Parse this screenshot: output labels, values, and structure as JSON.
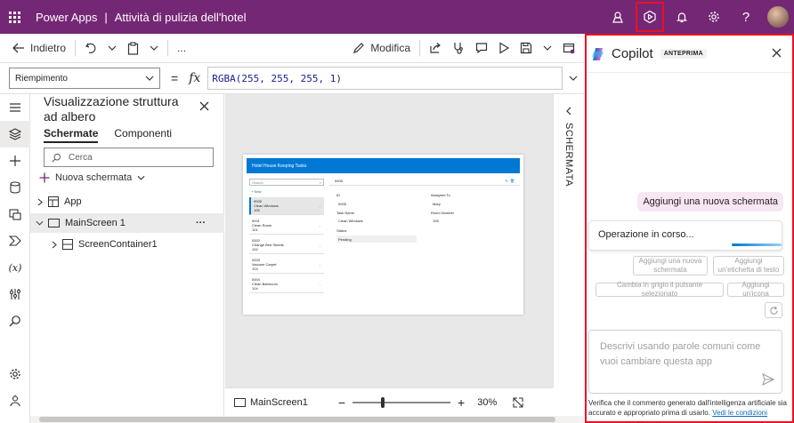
{
  "topbar": {
    "app_name": "Power Apps",
    "separator": "|",
    "document_title": "Attività di pulizia dell'hotel",
    "icons": [
      "environment-icon",
      "copilot-icon",
      "bell-icon",
      "gear-icon",
      "help-icon",
      "avatar"
    ],
    "bg_color": "#742774"
  },
  "commands": {
    "back_label": "Indietro",
    "more_label": "...",
    "edit_label": "Modifica"
  },
  "formula": {
    "property": "Riempimento",
    "equals": "=",
    "fx": "fx",
    "expression": "RGBA(255, 255, 255, 1)"
  },
  "tree": {
    "title": "Visualizzazione struttura ad albero",
    "tabs": [
      "Schermate",
      "Componenti"
    ],
    "search_placeholder": "Cerca",
    "new_screen_label": "Nuova schermata",
    "rows": [
      {
        "label": "App"
      },
      {
        "label": "MainScreen 1",
        "more": "···"
      },
      {
        "label": "ScreenContainer1"
      }
    ]
  },
  "canvas": {
    "app_header": "Hotel House Keeping Tasks",
    "mini_search": "Search",
    "mini_new": "+ New",
    "list_items": [
      {
        "id": "0005",
        "task": "Clean Windows",
        "room": "105"
      },
      {
        "id": "0001",
        "task": "Clean Room",
        "room": "101"
      },
      {
        "id": "0002",
        "task": "Change Bed Sheets",
        "room": "102"
      },
      {
        "id": "0003",
        "task": "Vacuum Carpet",
        "room": "103"
      },
      {
        "id": "0004",
        "task": "Clean Bathroom",
        "room": "104"
      }
    ],
    "detail": {
      "bar_id": "0005",
      "id_label": "ID",
      "id_value": "0005",
      "assigned_label": "Assigned To",
      "assigned_value": "Mary",
      "task_label": "Task Name",
      "task_value": "Clean Windows",
      "room_label": "Room Number",
      "room_value": "105",
      "status_label": "Status",
      "status_value": "Pending"
    },
    "side_label": "SCHERMATA"
  },
  "zoom": {
    "screen_name": "MainScreen1",
    "minus": "−",
    "plus": "+",
    "level": "30%",
    "level_fraction": 0.3
  },
  "copilot": {
    "title": "Copilot",
    "badge": "ANTEPRIMA",
    "user_message": "Aggiungi una nuova schermata",
    "progress_text": "Operazione in corso...",
    "suggestions": [
      "Aggiungi una nuova schermata",
      "Aggiungi un'etichetta di testo",
      "Cambia in grigio il pulsante selezionato",
      "Aggiungi un'icona"
    ],
    "input_placeholder": "Descrivi usando parole comuni come vuoi cambiare questa app",
    "footer_text": "Verifica che il commento generato dall'intelligenza artificiale sia accurato e appropriato prima di usarlo.",
    "footer_link": "Vedi le condizioni"
  }
}
